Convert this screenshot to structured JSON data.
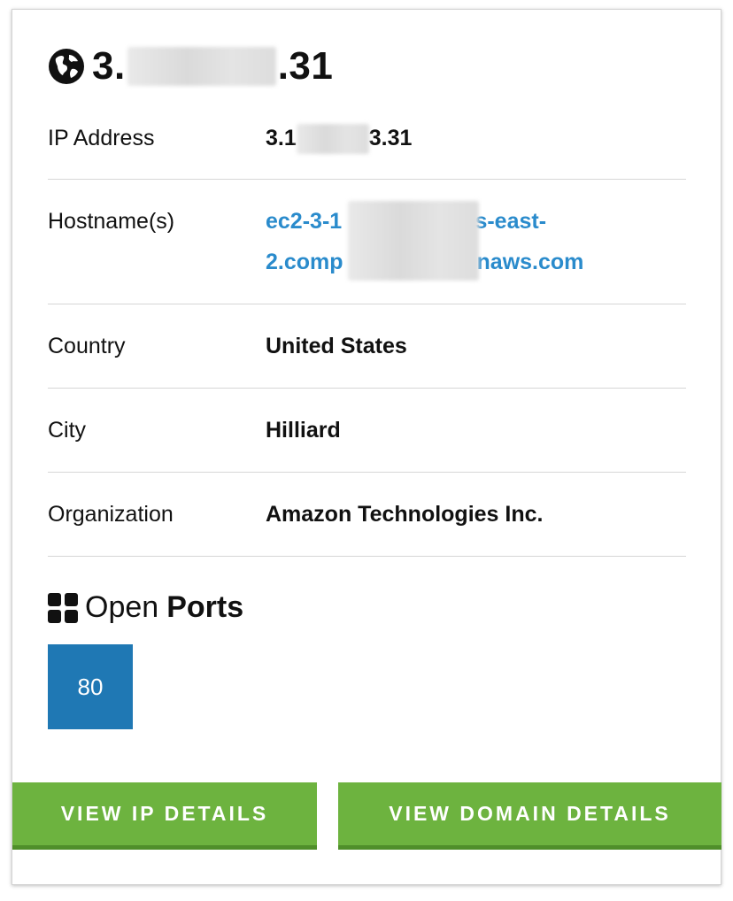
{
  "header": {
    "ip_prefix": "3.",
    "ip_suffix": ".31",
    "globe_icon": "globe-icon"
  },
  "details": {
    "ip_address": {
      "label": "IP Address",
      "prefix": "3.1",
      "suffix": "3.31"
    },
    "hostnames": {
      "label": "Hostname(s)",
      "line1_prefix": "ec2-3-1",
      "line1_suffix": "us-east-",
      "line2_prefix": "2.comp",
      "line2_suffix": "naws.com"
    },
    "country": {
      "label": "Country",
      "value": "United States"
    },
    "city": {
      "label": "City",
      "value": "Hilliard"
    },
    "organization": {
      "label": "Organization",
      "value": "Amazon Technologies Inc."
    }
  },
  "ports": {
    "heading_light": "Open",
    "heading_bold": "Ports",
    "icon": "grid-icon",
    "items": [
      "80"
    ]
  },
  "actions": {
    "view_ip": "VIEW IP DETAILS",
    "view_domain": "VIEW DOMAIN DETAILS"
  },
  "colors": {
    "link": "#2a8bcc",
    "port_badge": "#1f78b4",
    "button_green": "#6db33f"
  }
}
